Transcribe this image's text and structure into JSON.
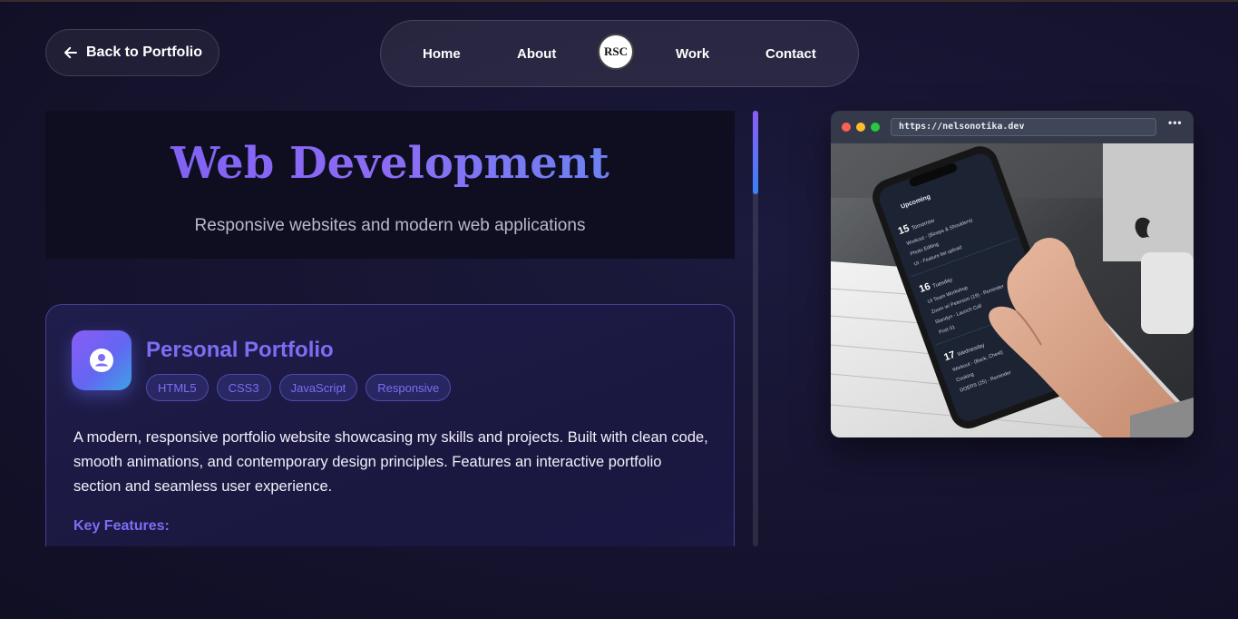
{
  "back_button": {
    "label": "Back to Portfolio",
    "icon": "arrow-left-icon"
  },
  "nav": {
    "links": [
      "Home",
      "About",
      "Work",
      "Contact"
    ],
    "logo_text": "RSC"
  },
  "hero": {
    "title": "Web Development",
    "subtitle": "Responsive websites and modern web applications"
  },
  "project": {
    "icon": "user-circle-icon",
    "title": "Personal Portfolio",
    "tags": [
      "HTML5",
      "CSS3",
      "JavaScript",
      "Responsive"
    ],
    "description": "A modern, responsive portfolio website showcasing my skills and projects. Built with clean code, smooth animations, and contemporary design principles. Features an interactive portfolio section and seamless user experience.",
    "key_features_label": "Key Features:"
  },
  "preview": {
    "url": "https://nelsonotika.dev",
    "menu": "•••",
    "app_header": "Upcoming",
    "days": [
      {
        "day": "15",
        "label": "Tomorrow",
        "tasks": [
          "Workout - (Biceps & Shoulders)",
          "Photo Editing",
          "UI - Feature list upload"
        ]
      },
      {
        "day": "16",
        "label": "Tuesday",
        "tasks": [
          "UI Team Workshop",
          "Zoom w/ Peterson (19) - Reminder",
          "Standyn - Launch Call",
          "Post 01"
        ]
      },
      {
        "day": "17",
        "label": "Wednesday",
        "tasks": [
          "Workout - (Back, Chest)",
          "Cooking",
          "DOERS (25) - Reminder"
        ]
      }
    ]
  },
  "colors": {
    "accent": "#7b6ef5",
    "gradient_start": "#8b5cf6",
    "gradient_end": "#3b82f6",
    "background": "#15132e"
  }
}
